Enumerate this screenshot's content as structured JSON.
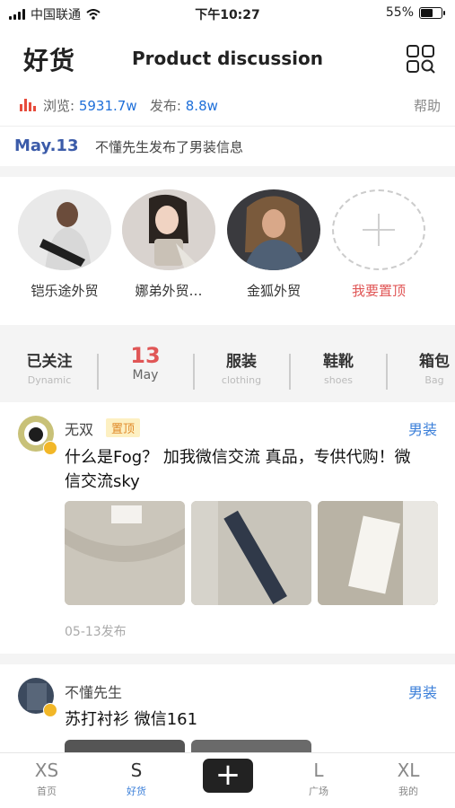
{
  "status_bar": {
    "carrier": "中国联通",
    "time": "下午10:27",
    "battery": "55%",
    "battery_level": 0.55
  },
  "header": {
    "brand": "好货",
    "title": "Product discussion",
    "menu_icon": "grid-search-icon"
  },
  "stats": {
    "views_label": "浏览:",
    "views_value": "5931.7w",
    "posts_label": "发布:",
    "posts_value": "8.8w",
    "help": "帮助"
  },
  "notice": {
    "date": "May.13",
    "message": "不懂先生发布了男装信息"
  },
  "stories": [
    {
      "name": "铠乐途外贸"
    },
    {
      "name": "娜弟外贸…"
    },
    {
      "name": "金狐外贸"
    },
    {
      "name": "我要置顶"
    }
  ],
  "tabs": [
    {
      "title": "已关注",
      "sub": "Dynamic"
    },
    {
      "title": "13",
      "sub": "May"
    },
    {
      "title": "服装",
      "sub": "clothing"
    },
    {
      "title": "鞋靴",
      "sub": "shoes"
    },
    {
      "title": "箱包",
      "sub": "Bag"
    }
  ],
  "posts": [
    {
      "user": "无双",
      "pin": "置顶",
      "category": "男装",
      "text": "什么是Fog？ 加我微信交流 真品，专供代购！微信交流sky",
      "time": "05-13发布"
    },
    {
      "user": "不懂先生",
      "category": "男装",
      "text": "苏打衬衫 微信161"
    }
  ],
  "bottom_nav": [
    {
      "icon": "XS",
      "label": "首页"
    },
    {
      "icon": "S",
      "label": "好货"
    },
    {
      "icon": "+",
      "label": ""
    },
    {
      "icon": "L",
      "label": "广场"
    },
    {
      "icon": "XL",
      "label": "我的"
    }
  ],
  "colors": {
    "accent_blue": "#3b7fd9",
    "accent_red": "#e05656",
    "date_blue": "#3b5ba9"
  }
}
